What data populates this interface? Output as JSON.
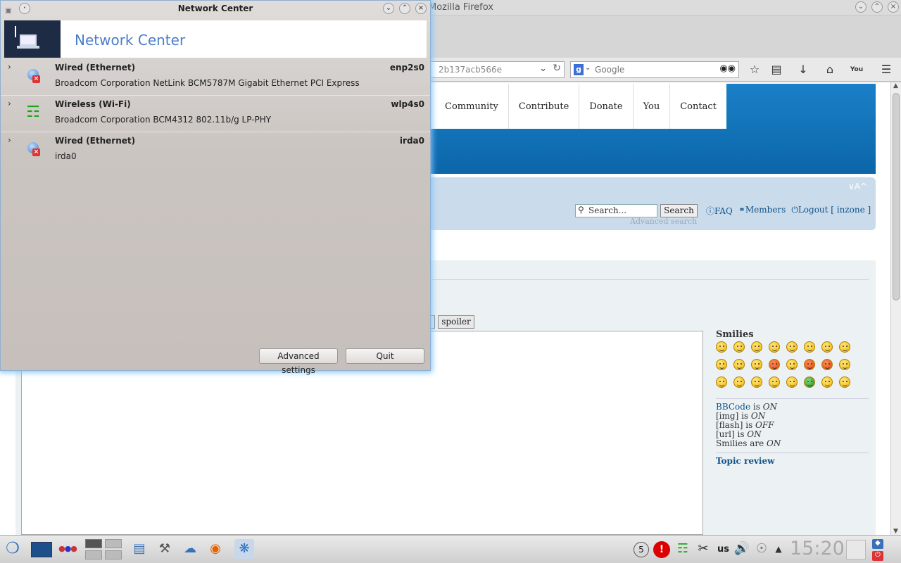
{
  "firefox": {
    "title": "Post a reply - Mozilla Firefox",
    "url_fragment": "2b137acb566e",
    "search_placeholder": "Google",
    "search_engine_icon": "g",
    "nav_items": [
      "Community",
      "Contribute",
      "Donate",
      "You",
      "Contact"
    ],
    "font_size_control": "∨A^",
    "forum_search_placeholder": "Search...",
    "forum_search_button": "Search",
    "advanced_search": "Advanced search",
    "quick_links": {
      "faq": "FAQ",
      "members": "Members",
      "logout": "Logout [ inzone ]"
    },
    "spoiler_button": "spoiler",
    "smilies_heading": "Smilies",
    "bbcode_link": "BBCode",
    "bbcode_status": [
      {
        "pre": "",
        "label": "BBCode",
        "mid": " is ",
        "val": "ON"
      },
      {
        "pre": "[img]",
        "label": "",
        "mid": " is ",
        "val": "ON"
      },
      {
        "pre": "[flash]",
        "label": "",
        "mid": " is ",
        "val": "OFF"
      },
      {
        "pre": "[url]",
        "label": "",
        "mid": " is ",
        "val": "ON"
      },
      {
        "pre": "Smilies",
        "label": "",
        "mid": " are ",
        "val": "ON"
      }
    ],
    "topic_review": "Topic review"
  },
  "network_center": {
    "window_title": "Network Center",
    "banner_title": "Network Center",
    "interfaces": [
      {
        "name": "Wired (Ethernet)",
        "device": "enp2s0",
        "description": "Broadcom Corporation NetLink BCM5787M Gigabit Ethernet PCI Express",
        "icon": "wired-disconnected-icon"
      },
      {
        "name": "Wireless (Wi-Fi)",
        "device": "wlp4s0",
        "description": "Broadcom Corporation BCM4312 802.11b/g LP-PHY",
        "icon": "wifi-icon"
      },
      {
        "name": "Wired (Ethernet)",
        "device": "irda0",
        "description": "irda0",
        "icon": "wired-disconnected-icon"
      }
    ],
    "advanced_button": "Advanced settings",
    "quit_button": "Quit"
  },
  "taskbar": {
    "keyboard_layout": "us",
    "clock": "15:20",
    "badge": "5"
  },
  "colors": {
    "accent": "#4a7ec8",
    "forum_blue": "#0c66a8",
    "link": "#105289"
  }
}
